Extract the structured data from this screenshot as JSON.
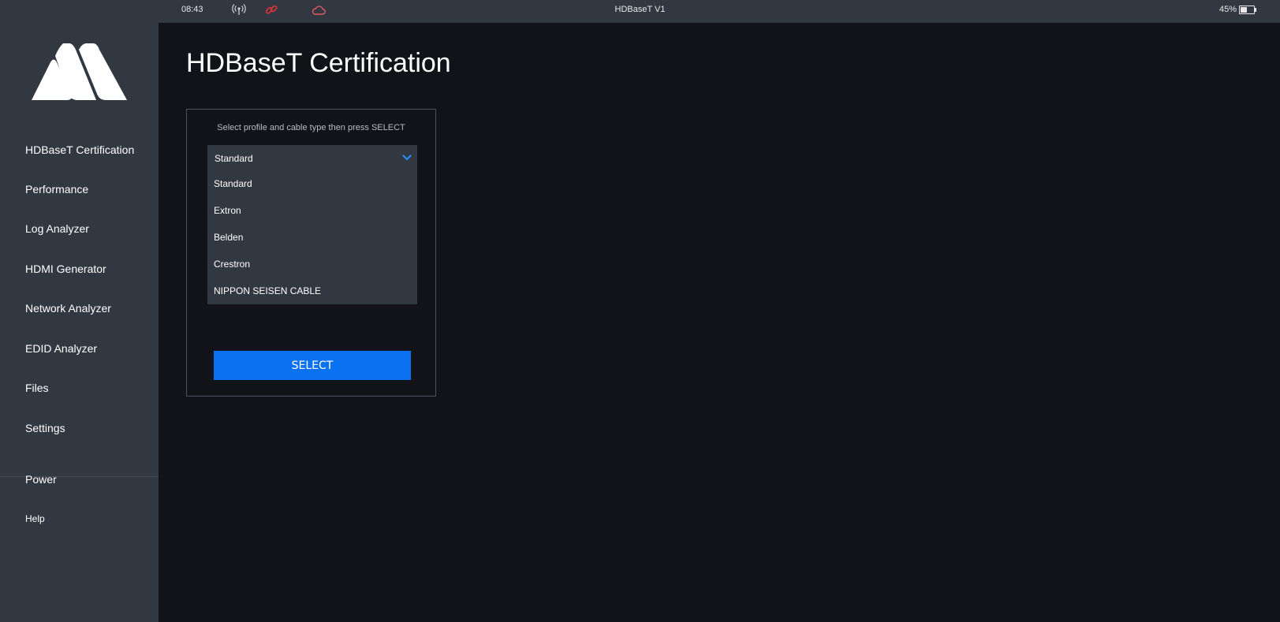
{
  "status_bar": {
    "time": "08:43",
    "title": "HDBaseT V1",
    "battery_text": "45%",
    "battery_level": 0.45,
    "icons": [
      "antenna-icon",
      "link-icon",
      "cloud-icon"
    ],
    "link_color": "#e0333a",
    "cloud_color": "#e05a5f"
  },
  "sidebar": {
    "items": [
      {
        "label": "HDBaseT Certification"
      },
      {
        "label": "Performance"
      },
      {
        "label": "Log Analyzer"
      },
      {
        "label": "HDMI Generator"
      },
      {
        "label": "Network Analyzer"
      },
      {
        "label": "EDID Analyzer"
      },
      {
        "label": "Files"
      },
      {
        "label": "Settings"
      }
    ],
    "footer_items": [
      {
        "label": "Power"
      },
      {
        "label": "Help"
      }
    ]
  },
  "main": {
    "title": "HDBaseT Certification",
    "instructions": "Select profile and cable type then press SELECT",
    "dropdown": {
      "selected": "Standard",
      "options": [
        "Standard",
        "Extron",
        "Belden",
        "Crestron",
        "NIPPON SEISEN CABLE"
      ]
    },
    "select_button": "SELECT",
    "accent_color": "#0a72f0"
  }
}
